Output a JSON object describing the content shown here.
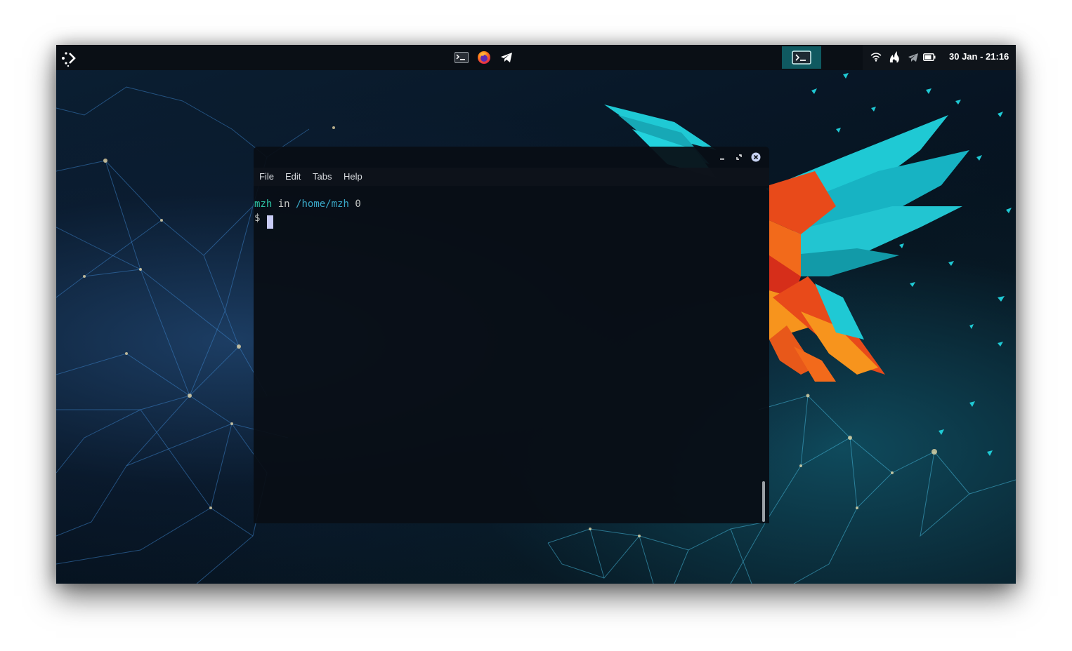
{
  "panel": {
    "clock": "30 Jan - 21:16",
    "activities_icon": "activities-dots-icon",
    "dock_apps": [
      {
        "name": "terminal",
        "icon": "terminal-icon"
      },
      {
        "name": "firefox",
        "icon": "firefox-icon"
      },
      {
        "name": "telegram",
        "icon": "telegram-icon"
      }
    ],
    "running_app_icon": "terminal-icon",
    "tray_icons": [
      "wifi-icon",
      "flame-icon",
      "telegram-tray-icon",
      "battery-icon"
    ]
  },
  "terminal": {
    "menu": [
      "File",
      "Edit",
      "Tabs",
      "Help"
    ],
    "prompt": {
      "user": "mzh",
      "in_word": "in",
      "path": "/home/mzh",
      "exit_code": "0",
      "symbol": "$"
    }
  },
  "colors": {
    "panel_bg": "#0a0f15",
    "running_highlight": "#0f5960",
    "prompt_user": "#2ec4a6",
    "prompt_path": "#3aa9c9",
    "terminal_bg": "#090e15",
    "accent_cyan": "#1fc9d4",
    "accent_orange": "#f26a1b"
  }
}
